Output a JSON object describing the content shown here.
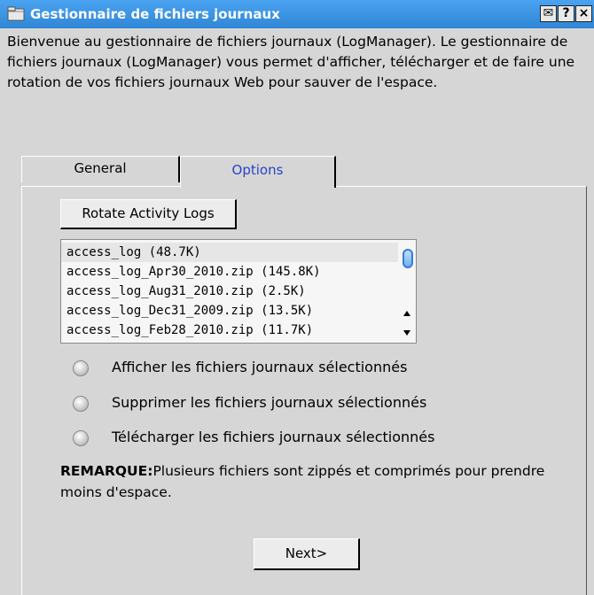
{
  "window": {
    "title": "Gestionnaire de fichiers journaux",
    "buttons": [
      "✉",
      "?",
      "×"
    ]
  },
  "intro": "Bienvenue au gestionnaire de fichiers journaux (LogManager). Le gestionnaire de fichiers journaux (LogManager) vous permet d'afficher, télécharger et de faire une rotation de vos fichiers journaux Web pour sauver de l'espace.",
  "tabs": [
    {
      "label": "General",
      "active": false
    },
    {
      "label": "Options",
      "active": true
    }
  ],
  "rotate_button": "Rotate Activity Logs",
  "log_files": [
    {
      "label": "access_log (48.7K)",
      "selected": true
    },
    {
      "label": "access_log_Apr30_2010.zip (145.8K)",
      "selected": false
    },
    {
      "label": "access_log_Aug31_2010.zip (2.5K)",
      "selected": false
    },
    {
      "label": "access_log_Dec31_2009.zip (13.5K)",
      "selected": false
    },
    {
      "label": "access_log_Feb28_2010.zip (11.7K)",
      "selected": false
    }
  ],
  "options": [
    {
      "label": "Afficher les fichiers journaux sélectionnés",
      "checked": false
    },
    {
      "label": "Supprimer les fichiers journaux sélectionnés",
      "checked": false
    },
    {
      "label": "Télécharger les fichiers journaux sélectionnés",
      "checked": false
    }
  ],
  "note": {
    "prefix": "REMARQUE:",
    "text": "Plusieurs fichiers sont zippés et comprimés pour prendre moins d'espace."
  },
  "next_button": "Next>",
  "colors": {
    "titlebar": "#2f86d6",
    "active_tab_text": "#2742c9",
    "window_bg": "#d6d6d6"
  }
}
